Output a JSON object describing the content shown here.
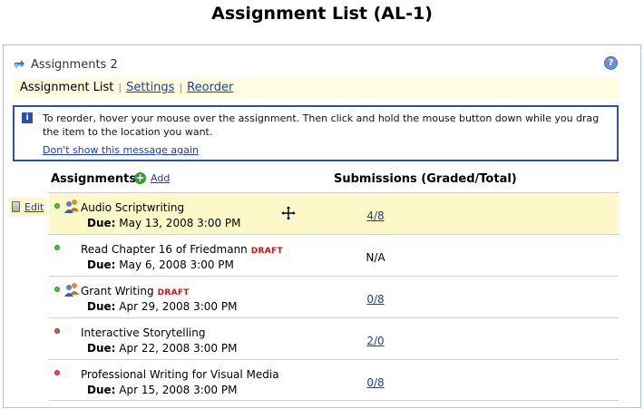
{
  "page": {
    "title": "Assignment List (AL-1)"
  },
  "tool": {
    "title": "Assignments 2",
    "help_icon": "help-icon",
    "tool_icon": "refresh-arrows-icon"
  },
  "nav": {
    "current": "Assignment List",
    "separator": "|",
    "settings": "Settings",
    "reorder": "Reorder"
  },
  "message": {
    "text": "To reorder, hover your mouse over the assignment.  Then click and hold the mouse button down while you drag the item to the location you want.",
    "dismiss": "Don't show this message again"
  },
  "list": {
    "header_assignments": "Assignments",
    "add_label": "Add",
    "header_submissions": "Submissions (Graded/Total)",
    "edit_label": "Edit",
    "due_label": "Due:",
    "draft_label": "DRAFT",
    "rows": [
      {
        "status": "green",
        "group": true,
        "title": "Audio Scriptwriting",
        "draft": false,
        "due": "May 13, 2008 3:00 PM",
        "submissions": "4/8",
        "link": true,
        "hover": true
      },
      {
        "status": "green",
        "group": false,
        "title": "Read Chapter 16 of Friedmann",
        "draft": true,
        "due": "May 6, 2008 3:00 PM",
        "submissions": "N/A",
        "link": false,
        "hover": false
      },
      {
        "status": "green",
        "group": true,
        "title": "Grant Writing",
        "draft": true,
        "due": "Apr 29, 2008 3:00 PM",
        "submissions": "0/8",
        "link": true,
        "hover": false
      },
      {
        "status": "red",
        "group": false,
        "title": "Interactive Storytelling",
        "draft": false,
        "due": "Apr 22, 2008 3:00 PM",
        "submissions": "2/0",
        "link": true,
        "hover": false
      },
      {
        "status": "red",
        "group": false,
        "title": "Professional Writing for Visual Media",
        "draft": false,
        "due": "Apr 15, 2008 3:00 PM",
        "submissions": "0/8",
        "link": true,
        "hover": false
      }
    ]
  }
}
